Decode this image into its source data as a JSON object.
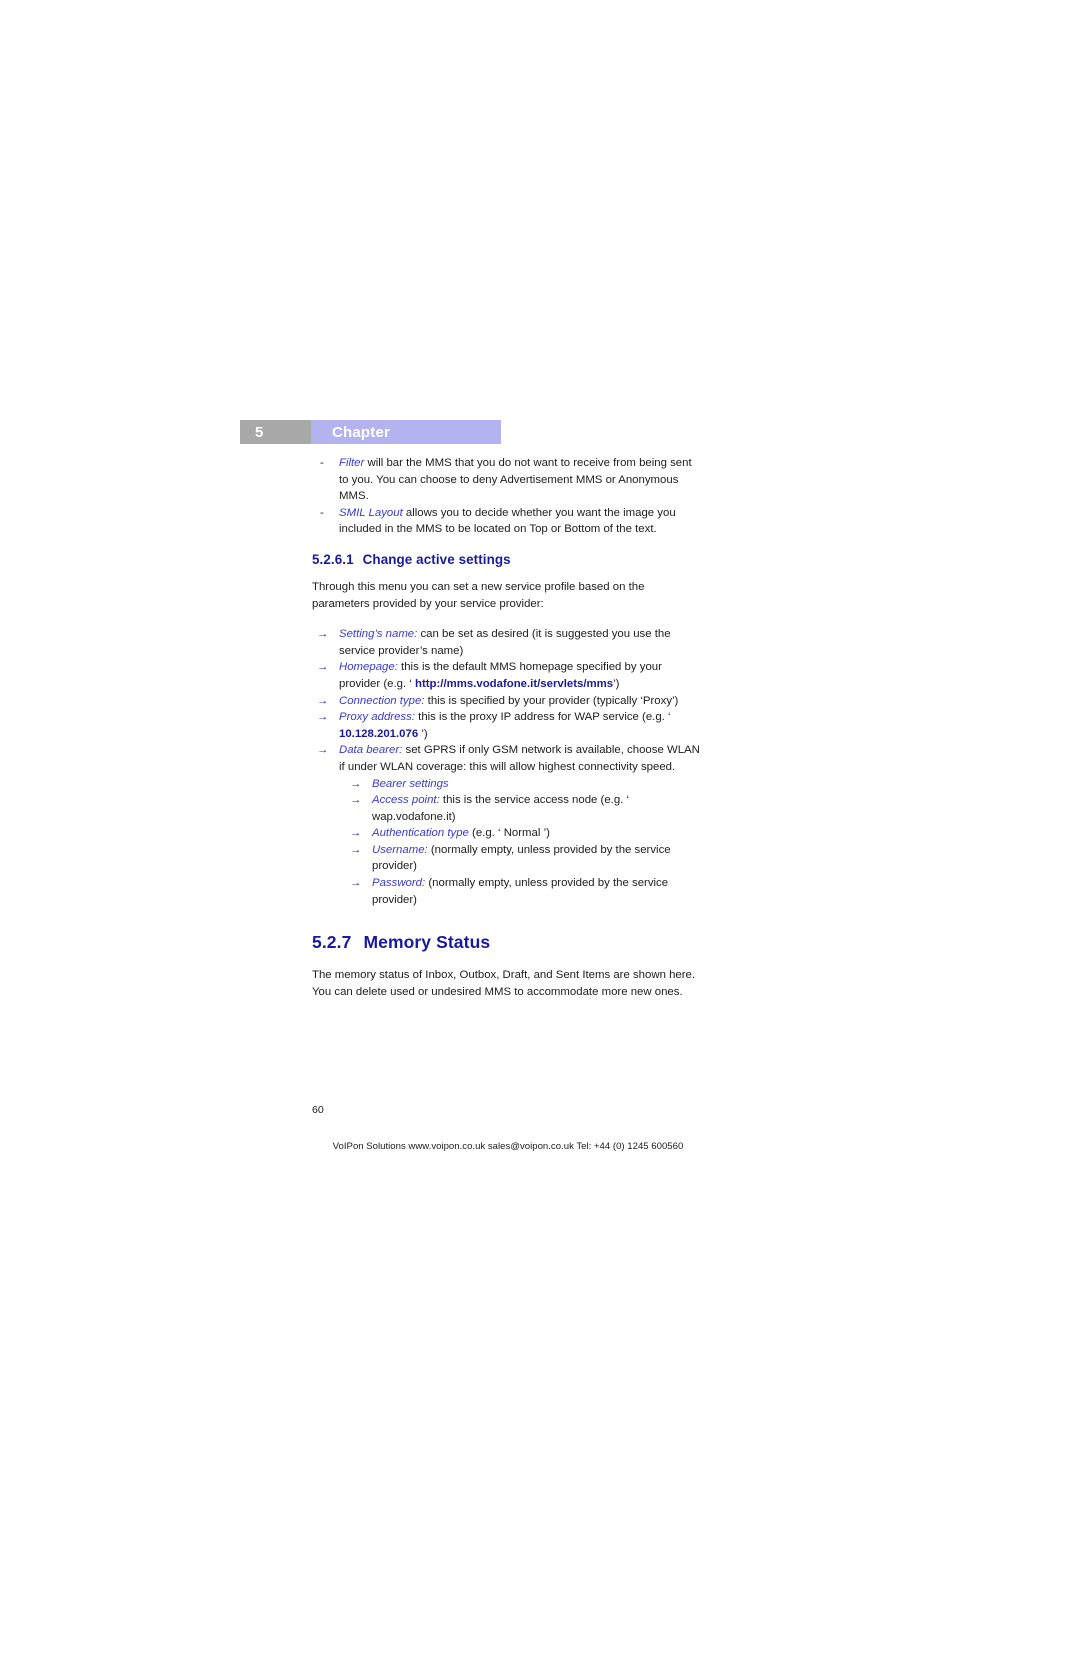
{
  "header": {
    "chapter_number": "5",
    "chapter_label": "Chapter"
  },
  "intro_bullets": [
    {
      "marker": "-",
      "term": "Filter",
      "rest": " will bar the MMS that you do not want to receive from being sent to you. You can choose to deny Advertisement MMS or Anonymous MMS."
    },
    {
      "marker": "-",
      "term": "SMIL Layout",
      "rest": " allows you to decide whether you want the image you included in the MMS to be located on Top or Bottom of the text."
    }
  ],
  "subsection": {
    "number": "5.2.6.1",
    "title": "Change active settings",
    "intro": "Through this menu you can set a new service profile based on the parameters provided by your service provider:"
  },
  "settings_bullets": [
    {
      "marker": "→",
      "term": "Setting’s name:",
      "rest": "  can be set as desired (it is suggested you use the service provider’s name)",
      "level": "top"
    },
    {
      "marker": "→",
      "term": "Homepage:",
      "rest": "  this is the default MMS homepage specified by your provider (e.g. ‘ ",
      "strong": "http://mms.vodafone.it/servlets/mms",
      "tail": "’)",
      "level": "top"
    },
    {
      "marker": "→",
      "term": "Connection type:",
      "rest": " this is specified by your provider (typically ‘Proxy’)",
      "level": "top"
    },
    {
      "marker": "→",
      "term": "Proxy address:",
      "rest": " this is the proxy IP address for WAP service (e.g. ‘ ",
      "strong": "10.128.201.076",
      "tail": " ’)",
      "level": "top"
    },
    {
      "marker": "→",
      "term": "Data bearer:",
      "rest": " set GPRS if only GSM network is available, choose WLAN if under WLAN coverage: this will allow highest connectivity speed.",
      "level": "top"
    },
    {
      "marker": "→",
      "term": "Bearer settings",
      "rest": "",
      "level": "sub"
    },
    {
      "marker": "→",
      "term": "Access point:",
      "rest": " this is the service access node (e.g. ‘ wap.vodafone.it)",
      "level": "sub"
    },
    {
      "marker": "→",
      "term": "Authentication type",
      "rest": " (e.g. ‘ Normal ’)",
      "level": "sub"
    },
    {
      "marker": "→",
      "term": "Username:",
      "rest": " (normally empty, unless provided by the service provider)",
      "level": "sub"
    },
    {
      "marker": "→",
      "term": "Password:",
      "rest": " (normally empty, unless provided by the service provider)",
      "level": "sub"
    }
  ],
  "section": {
    "number": "5.2.7",
    "title": "Memory Status",
    "body": "The memory status of Inbox, Outbox, Draft, and Sent Items are shown here. You can delete used or undesired MMS to accommodate more new ones."
  },
  "footer": {
    "page_number": "60",
    "text": "VoIPon Solutions www.voipon.co.uk sales@voipon.co.uk Tel: +44 (0) 1245 600560"
  },
  "colors": {
    "heading_blue": "#1a1aa0",
    "term_blue": "#3a3ad0",
    "chapter_bar": "#b3b3f0",
    "chapter_num_bar": "#a8a8a8"
  }
}
